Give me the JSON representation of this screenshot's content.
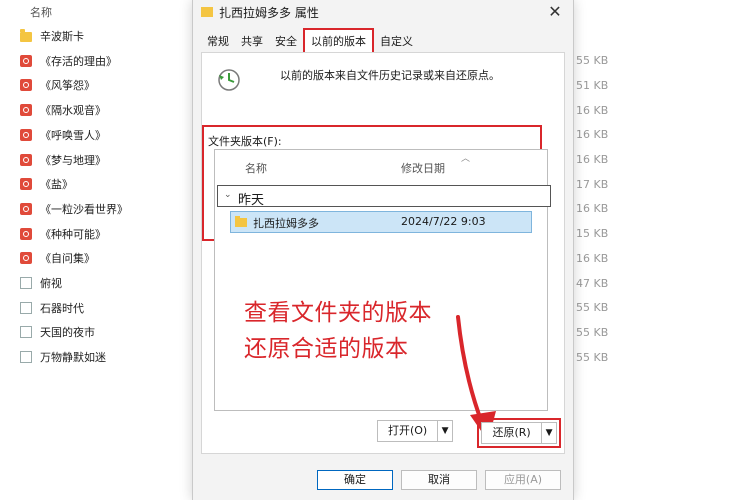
{
  "background_list": {
    "header": "名称",
    "items": [
      {
        "name": "辛波斯卡",
        "icon": "folder-icon",
        "size": ""
      },
      {
        "name": "《存活的理由》",
        "icon": "epub-icon",
        "size": "55 KB"
      },
      {
        "name": "《风筝怨》",
        "icon": "epub-icon",
        "size": "51 KB"
      },
      {
        "name": "《隔水观音》",
        "icon": "epub-icon",
        "size": "16 KB"
      },
      {
        "name": "《呼唤雪人》",
        "icon": "epub-icon",
        "size": "16 KB"
      },
      {
        "name": "《梦与地理》",
        "icon": "epub-icon",
        "size": "16 KB"
      },
      {
        "name": "《盐》",
        "icon": "epub-icon",
        "size": "17 KB"
      },
      {
        "name": "《一粒沙看世界》",
        "icon": "epub-icon",
        "size": "16 KB"
      },
      {
        "name": "《种种可能》",
        "icon": "epub-icon",
        "size": "15 KB"
      },
      {
        "name": "《自问集》",
        "icon": "epub-icon",
        "size": "16 KB"
      },
      {
        "name": "俯视",
        "icon": "doc-icon",
        "size": "47 KB"
      },
      {
        "name": "石器时代",
        "icon": "doc-icon",
        "size": "55 KB"
      },
      {
        "name": "天国的夜市",
        "icon": "doc-icon",
        "size": "55 KB"
      },
      {
        "name": "万物静默如迷",
        "icon": "doc-icon",
        "size": "55 KB"
      }
    ]
  },
  "dialog": {
    "title": "扎西拉姆多多 属性",
    "tabs": [
      {
        "label": "常规",
        "active": false
      },
      {
        "label": "共享",
        "active": false
      },
      {
        "label": "安全",
        "active": false
      },
      {
        "label": "以前的版本",
        "active": true
      },
      {
        "label": "自定义",
        "active": false
      }
    ],
    "description": "以前的版本来自文件历史记录或来自还原点。",
    "versions_label": "文件夹版本(F):",
    "columns": {
      "name": "名称",
      "date": "修改日期"
    },
    "group": "昨天",
    "selected_item": {
      "name": "扎西拉姆多多",
      "date": "2024/7/22 9:03"
    },
    "annotation_lines": [
      "查看文件夹的版本",
      "还原合适的版本"
    ],
    "open_button": "打开(O)",
    "restore_button": "还原(R)",
    "footer": {
      "ok": "确定",
      "cancel": "取消",
      "apply": "应用(A)"
    }
  },
  "colors": {
    "highlight": "#d9262b",
    "selection": "#cce5f7"
  }
}
